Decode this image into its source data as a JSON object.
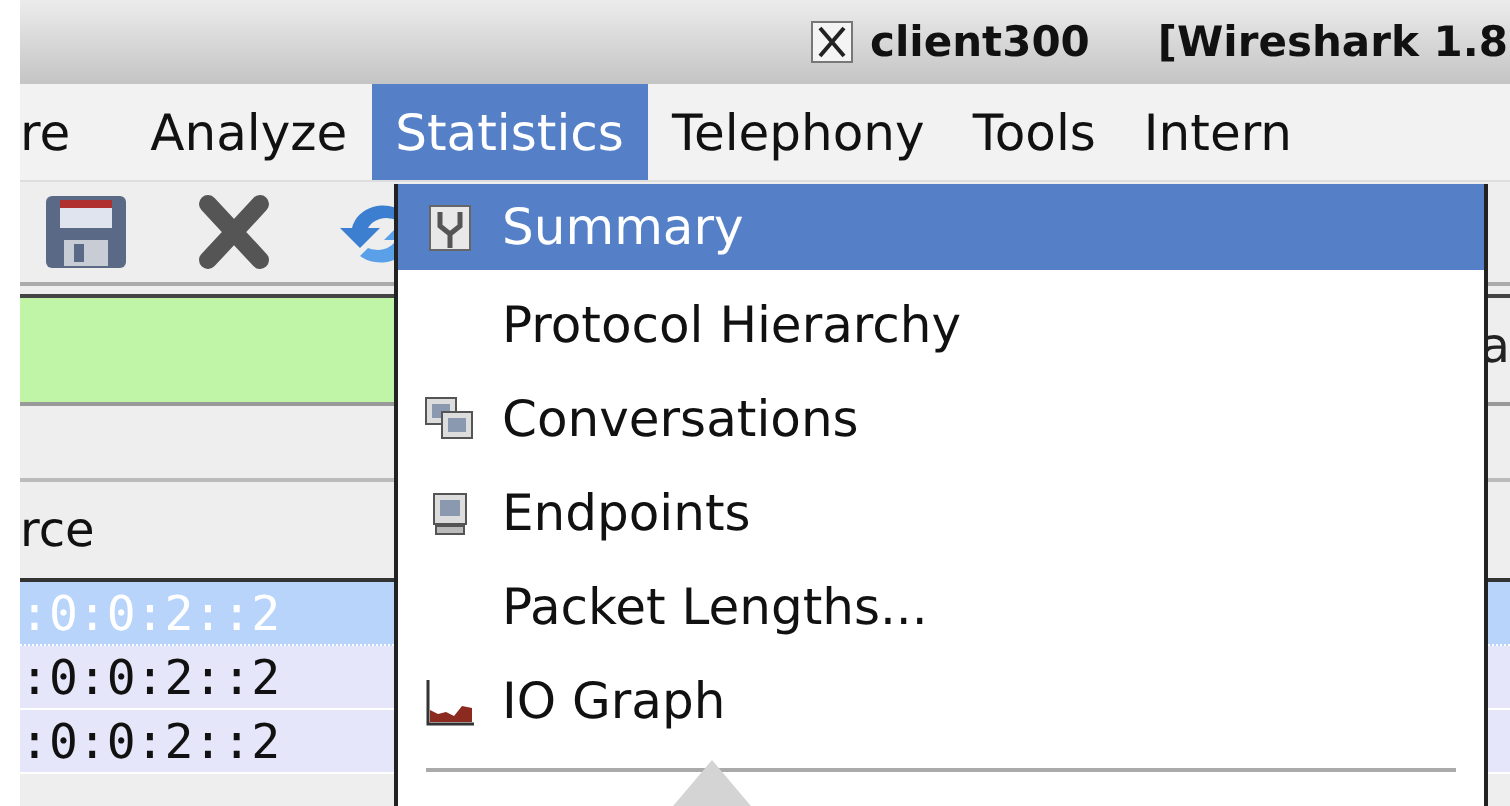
{
  "window": {
    "title": "client300",
    "title_suffix": "[Wireshark 1.8"
  },
  "menu_bar": [
    {
      "label": "re",
      "selected": false
    },
    {
      "label": "Analyze",
      "selected": false
    },
    {
      "label": "Statistics",
      "selected": true
    },
    {
      "label": "Telephony",
      "selected": false
    },
    {
      "label": "Tools",
      "selected": false
    },
    {
      "label": "Intern",
      "selected": false
    }
  ],
  "toolbar": [
    {
      "kind": "save"
    },
    {
      "kind": "close"
    },
    {
      "kind": "reload"
    }
  ],
  "filter_bar": {
    "button_fragment": "a"
  },
  "packet_list": {
    "column_header": "rce",
    "rows": [
      {
        "source": ":0:0:2::2",
        "selected": true
      },
      {
        "source": ":0:0:2::2",
        "selected": false
      },
      {
        "source": ":0:0:2::2",
        "selected": false
      }
    ]
  },
  "dropdown": {
    "items": [
      {
        "label": "Summary",
        "kind": "summary",
        "selected": true
      },
      {
        "label": "Protocol Hierarchy",
        "kind": "plain",
        "selected": false
      },
      {
        "label": "Conversations",
        "kind": "conversations",
        "selected": false
      },
      {
        "label": "Endpoints",
        "kind": "endpoints",
        "selected": false
      },
      {
        "label": "Packet Lengths...",
        "kind": "plain",
        "selected": false
      },
      {
        "label": "IO Graph",
        "kind": "graph",
        "selected": false
      }
    ]
  }
}
